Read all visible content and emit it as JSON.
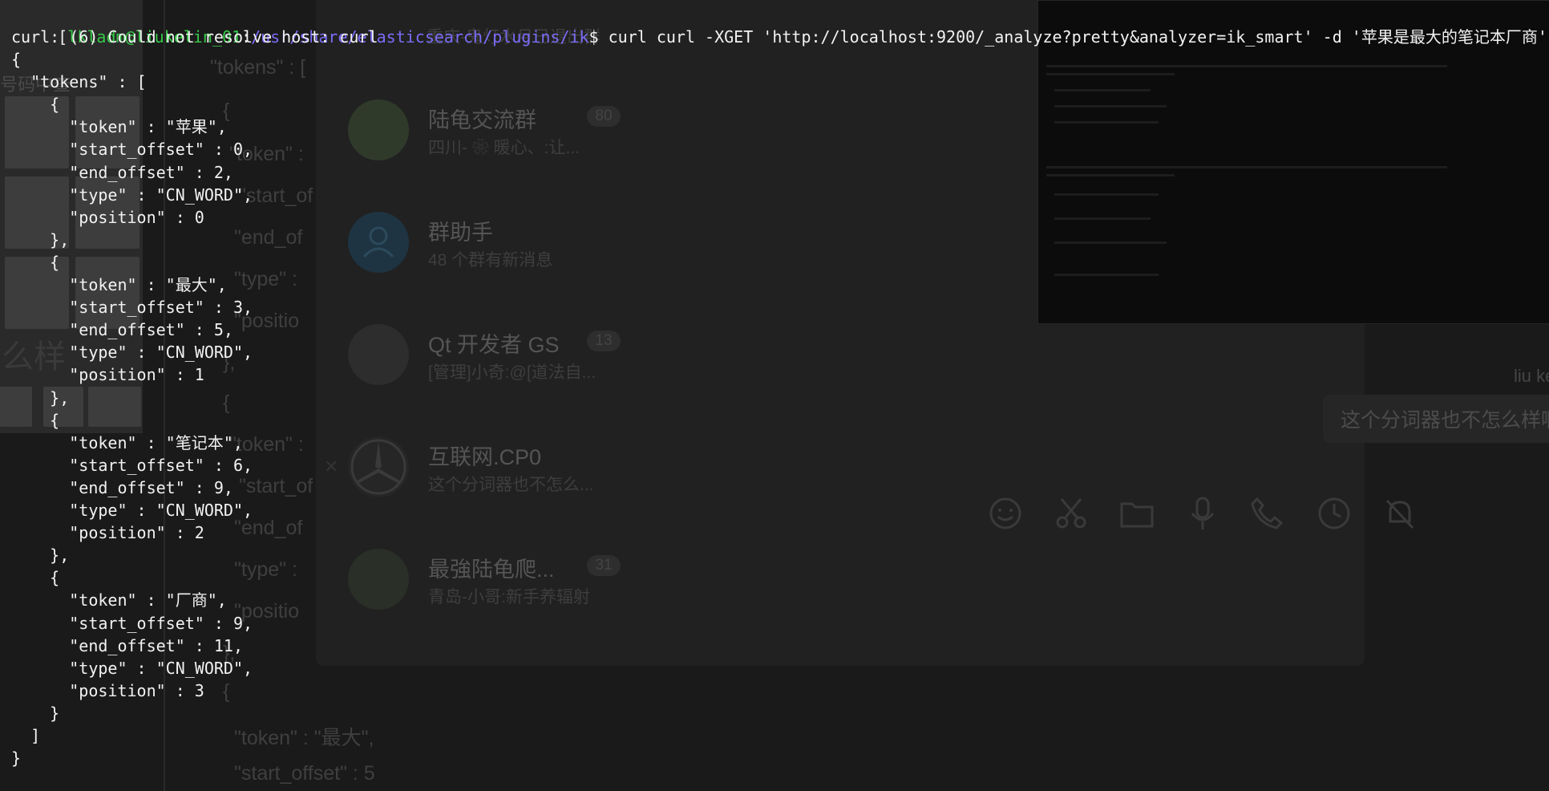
{
  "terminal": {
    "prompt_user": "lkladm@liukelin_01",
    "prompt_path": "/usr/share/elasticsearch/plugins/ik",
    "prompt_symbol": "$",
    "command": "curl curl -XGET 'http://localhost:9200/_analyze?pretty&analyzer=ik_smart' -d '苹果是最大的笔记本厂商'",
    "error_line": "curl: (6) Could not resolve host: curl",
    "output_lines": [
      "{",
      "  \"tokens\" : [",
      "    {",
      "      \"token\" : \"苹果\",",
      "      \"start_offset\" : 0,",
      "      \"end_offset\" : 2,",
      "      \"type\" : \"CN_WORD\",",
      "      \"position\" : 0",
      "    },",
      "    {",
      "      \"token\" : \"最大\",",
      "      \"start_offset\" : 3,",
      "      \"end_offset\" : 5,",
      "      \"type\" : \"CN_WORD\",",
      "      \"position\" : 1",
      "    },",
      "    {",
      "      \"token\" : \"笔记本\",",
      "      \"start_offset\" : 6,",
      "      \"end_offset\" : 9,",
      "      \"type\" : \"CN_WORD\",",
      "      \"position\" : 2",
      "    },",
      "    {",
      "      \"token\" : \"厂商\",",
      "      \"start_offset\" : 9,",
      "      \"end_offset\" : 11,",
      "      \"type\" : \"CN_WORD\",",
      "      \"position\" : 3",
      "    }",
      "  ]",
      "}"
    ]
  },
  "background_chat": {
    "chats": [
      {
        "name": "陆龟交流群",
        "preview": "四川-  ❀  暖心、:让...",
        "badge": "80"
      },
      {
        "name": "群助手",
        "preview": "48 个群有新消息",
        "badge": ""
      },
      {
        "name": "Qt 开发者 GS",
        "preview": "[管理]小奇:@[道法自...",
        "badge": "13"
      },
      {
        "name": "互联网.CP0",
        "preview": "这个分词器也不怎么...",
        "badge": ""
      },
      {
        "name": "最強陆龟爬...",
        "preview": "青岛-小哥:新手养辐射",
        "badge": "31"
      }
    ],
    "top_preview": "重庆-鬼灯水月已退出群",
    "message_sender": "liu kelin",
    "message_text": "这个分词器也不怎么样啊",
    "ghost_json_lines": [
      "\"tokens\" : [",
      "{",
      "\"token\" :",
      "\"start_of",
      "\"end_of",
      "\"type\" : ",
      "\"positio",
      "},",
      "{",
      "\"token\" :",
      "\"start_of",
      "\"end_of",
      "\"type\" : ",
      "\"positio",
      "},",
      "{",
      "\"token\" : \"最大\",",
      "\"start_offset\" : 5"
    ],
    "left_ghost_text": [
      "号码中查",
      "么样"
    ],
    "toolbar_icons": [
      "emoji-icon",
      "scissors-icon",
      "folder-icon",
      "microphone-icon",
      "phone-icon",
      "clock-icon",
      "bell-muted-icon"
    ]
  },
  "colors": {
    "prompt_user": "#35c947",
    "prompt_path": "#7b6cf7",
    "text": "#f2f2f2",
    "background": "#1a1a1a"
  }
}
